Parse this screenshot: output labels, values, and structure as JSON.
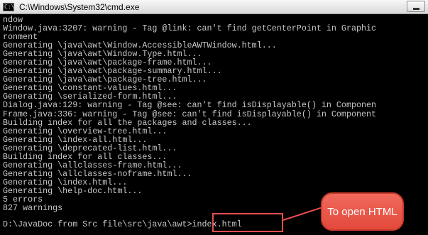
{
  "window": {
    "title": "C:\\Windows\\System32\\cmd.exe",
    "icon": "cmd-icon",
    "icon_glyph": "C:\\"
  },
  "console": {
    "lines": [
      "ndow",
      "Window.java:3207: warning - Tag @link: can't find getCenterPoint in Graphic",
      "ronment",
      "Generating \\java\\awt\\Window.AccessibleAWTWindow.html...",
      "Generating \\java\\awt\\Window.Type.html...",
      "Generating \\java\\awt\\package-frame.html...",
      "Generating \\java\\awt\\package-summary.html...",
      "Generating \\java\\awt\\package-tree.html...",
      "Generating \\constant-values.html...",
      "Generating \\serialized-form.html...",
      "Dialog.java:129: warning - Tag @see: can't find isDisplayable() in Componen",
      "Frame.java:336: warning - Tag @see: can't find isDisplayable() in Component",
      "Building index for all the packages and classes...",
      "Generating \\overview-tree.html...",
      "Generating \\index-all.html...",
      "Generating \\deprecated-list.html...",
      "Building index for all classes...",
      "Generating \\allclasses-frame.html...",
      "Generating \\allclasses-noframe.html...",
      "Generating \\index.html...",
      "Generating \\help-doc.html...",
      "5 errors",
      "827 warnings",
      ""
    ],
    "command_line": "D:\\JavaDoc from Src file\\src\\java\\awt>index.html"
  },
  "annotation": {
    "callout_text": "To open HTML",
    "color": "#e84d4d"
  },
  "colors": {
    "console_bg": "#000000",
    "console_text": "#c8c8c8"
  }
}
